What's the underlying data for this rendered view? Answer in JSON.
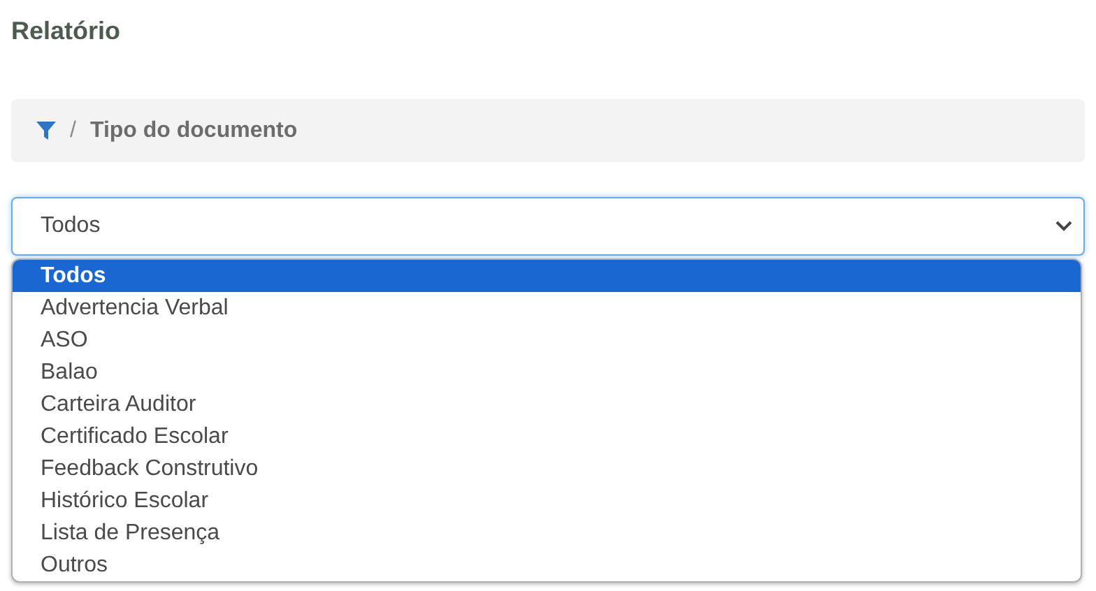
{
  "page_title": "Relatório",
  "breadcrumb": {
    "separator": "/",
    "label": "Tipo do documento"
  },
  "select": {
    "value": "Todos",
    "expanded": true,
    "options": [
      {
        "label": "Todos",
        "selected": true
      },
      {
        "label": "Advertencia Verbal",
        "selected": false
      },
      {
        "label": "ASO",
        "selected": false
      },
      {
        "label": "Balao",
        "selected": false
      },
      {
        "label": "Carteira Auditor",
        "selected": false
      },
      {
        "label": "Certificado Escolar",
        "selected": false
      },
      {
        "label": "Feedback Construtivo",
        "selected": false
      },
      {
        "label": "Histórico Escolar",
        "selected": false
      },
      {
        "label": "Lista de Presença",
        "selected": false
      },
      {
        "label": "Outros",
        "selected": false
      }
    ]
  }
}
